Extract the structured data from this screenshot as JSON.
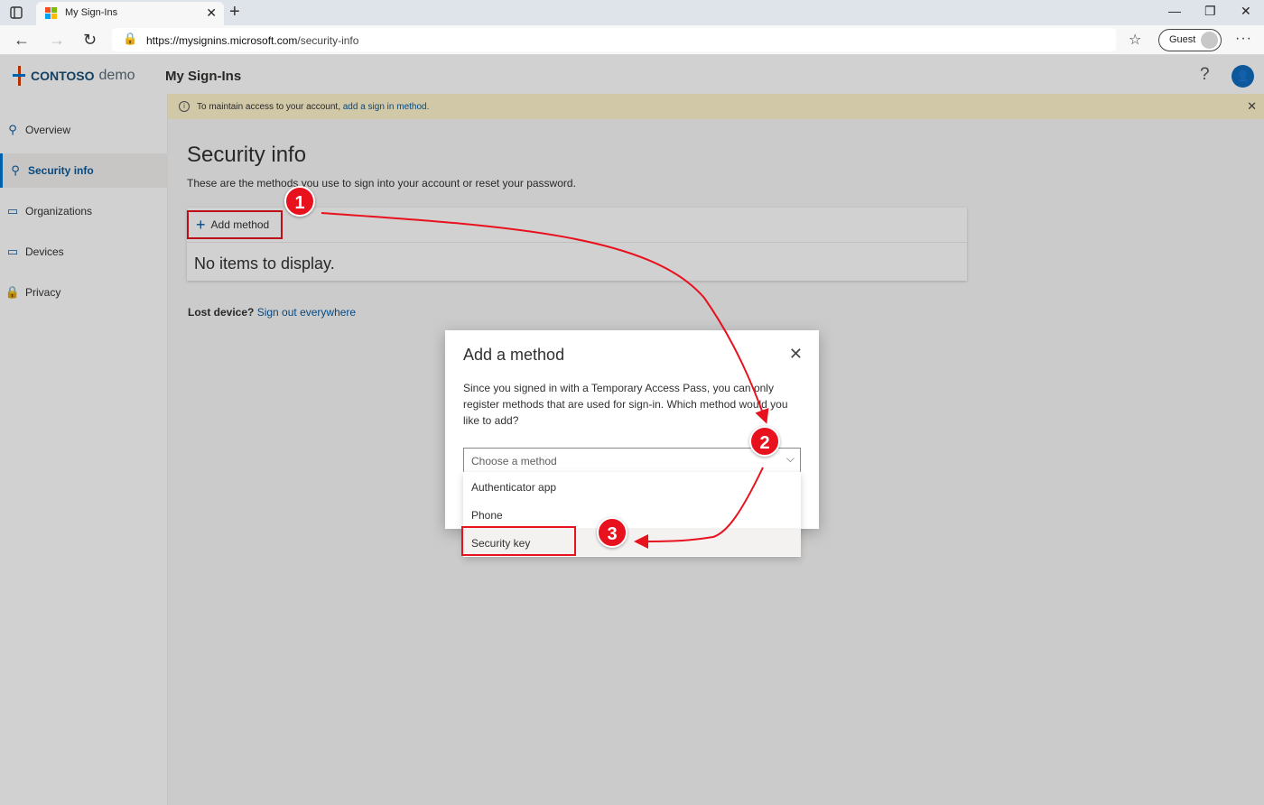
{
  "browser": {
    "tab_title": "My Sign-Ins",
    "url_host": "https://mysignins.microsoft.com",
    "url_path": "/security-info",
    "profile_label": "Guest"
  },
  "app": {
    "brand": "CONTOSO",
    "brand_suffix": "demo",
    "title": "My Sign-Ins",
    "help": "?"
  },
  "sidebar": {
    "items": [
      {
        "label": "Overview",
        "icon": "person-icon"
      },
      {
        "label": "Security info",
        "icon": "security-person-icon"
      },
      {
        "label": "Organizations",
        "icon": "organization-icon"
      },
      {
        "label": "Devices",
        "icon": "laptop-icon"
      },
      {
        "label": "Privacy",
        "icon": "lock-icon"
      }
    ]
  },
  "banner": {
    "text": "To maintain access to your account, ",
    "link": "add a sign in method."
  },
  "main": {
    "title": "Security info",
    "subtitle": "These are the methods you use to sign into your account or reset your password.",
    "add_method": "Add method",
    "empty": "No items to display.",
    "lost_prefix": "Lost device?",
    "lost_link": "Sign out everywhere"
  },
  "dialog": {
    "title": "Add a method",
    "text": "Since you signed in with a Temporary Access Pass, you can only register methods that are used for sign-in. Which method would you like to add?",
    "placeholder": "Choose a method",
    "options": [
      "Authenticator app",
      "Phone",
      "Security key"
    ]
  },
  "annotations": {
    "step1": "1",
    "step2": "2",
    "step3": "3",
    "color": "#e8121e"
  }
}
